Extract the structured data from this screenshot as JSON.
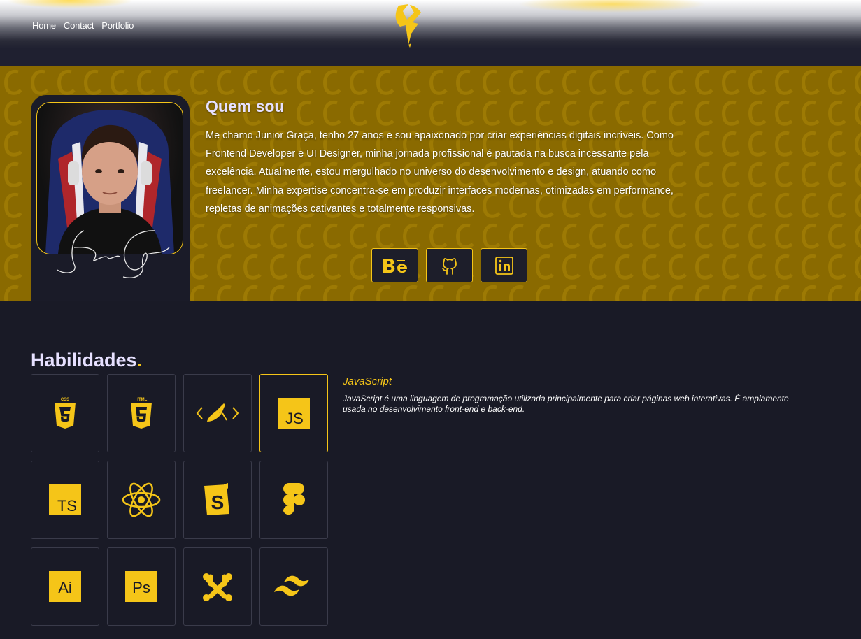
{
  "nav": {
    "items": [
      "Home",
      "Contact",
      "Portfolio"
    ]
  },
  "about": {
    "title": "Quem sou",
    "text": "Me chamo Junior Graça, tenho 27 anos e sou apaixonado por criar experiências digitais incríveis. Como Frontend Developer e UI Designer, minha jornada profissional é pautada na busca incessante pela excelência. Atualmente, estou mergulhado no universo do desenvolvimento e design, atuando como freelancer. Minha expertise concentra-se em produzir interfaces modernas, otimizadas em performance, repletas de animações cativantes e totalmente responsivas.",
    "socials": [
      {
        "name": "behance-icon"
      },
      {
        "name": "github-icon"
      },
      {
        "name": "linkedin-icon"
      }
    ]
  },
  "skills": {
    "title": "Habilidades",
    "title_dot": ".",
    "selected": {
      "name": "JavaScript",
      "description": "JavaScript é uma linguagem de programação utilizada principalmente para criar páginas web interativas. É amplamente usada no desenvolvimento front-end e back-end."
    },
    "items": [
      {
        "icon": "css3-icon",
        "label": "CSS"
      },
      {
        "icon": "html5-icon",
        "label": "HTML"
      },
      {
        "icon": "code-tool-icon"
      },
      {
        "icon": "javascript-icon",
        "label": "JS"
      },
      {
        "icon": "typescript-icon",
        "label": "TS"
      },
      {
        "icon": "react-icon"
      },
      {
        "icon": "storybook-icon",
        "label": "S"
      },
      {
        "icon": "figma-icon"
      },
      {
        "icon": "illustrator-icon",
        "label": "Ai"
      },
      {
        "icon": "photoshop-icon",
        "label": "Ps"
      },
      {
        "icon": "joomla-icon"
      },
      {
        "icon": "tailwind-icon"
      }
    ]
  },
  "colors": {
    "accent": "#f5c518",
    "background": "#191a26",
    "band": "#8a6a00"
  }
}
